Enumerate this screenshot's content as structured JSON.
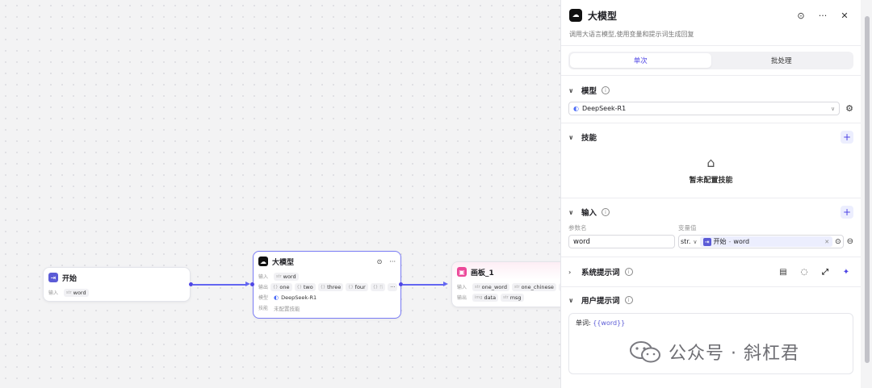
{
  "nodes": {
    "start": {
      "title": "开始",
      "input_label": "输入",
      "inputs": [
        {
          "type": "str",
          "name": "word"
        }
      ]
    },
    "llm": {
      "title": "大模型",
      "input_label": "输入",
      "inputs": [
        {
          "type": "str",
          "name": "word"
        }
      ],
      "output_label": "输出",
      "outputs": [
        {
          "type": "{}",
          "name": "one"
        },
        {
          "type": "{}",
          "name": "two"
        },
        {
          "type": "{}",
          "name": "three"
        },
        {
          "type": "{}",
          "name": "four"
        },
        {
          "type": "{}",
          "name": "fi"
        }
      ],
      "model_label": "模型",
      "model_value": "DeepSeek-R1",
      "skill_label": "技能",
      "skill_value": "未配置技能",
      "more": "···"
    },
    "canvas": {
      "title": "画板_1",
      "input_label": "输入",
      "inputs": [
        {
          "type": "str",
          "name": "one_word"
        },
        {
          "type": "str",
          "name": "one_chinese"
        },
        {
          "type": "str",
          "name": "o"
        }
      ],
      "output_label": "输出",
      "outputs": [
        {
          "type": "img",
          "name": "data"
        },
        {
          "type": "str",
          "name": "msg"
        }
      ]
    }
  },
  "panel": {
    "title": "大模型",
    "description": "调用大语言模型,使用变量和提示词生成回复",
    "tabs": [
      {
        "label": "单次",
        "active": true
      },
      {
        "label": "批处理",
        "active": false
      }
    ],
    "model_section": {
      "title": "模型",
      "selected": "DeepSeek-R1"
    },
    "skills_section": {
      "title": "技能",
      "empty_text": "暂未配置技能"
    },
    "input_section": {
      "title": "输入",
      "param_header": "参数名",
      "value_header": "变量值",
      "param_name": "word",
      "type": "str.",
      "ref_source": "开始",
      "ref_sep": "-",
      "ref_var": "word"
    },
    "system_prompt": {
      "title": "系统提示词"
    },
    "user_prompt": {
      "title": "用户提示词",
      "prefix": "单词:",
      "variable": "{{word}}"
    }
  },
  "watermark": {
    "text": "公众号 · 斜杠君"
  },
  "colors": {
    "accent": "#4f46e5",
    "edge": "#6366f1",
    "canvas_node_icon": "#ec4899"
  }
}
